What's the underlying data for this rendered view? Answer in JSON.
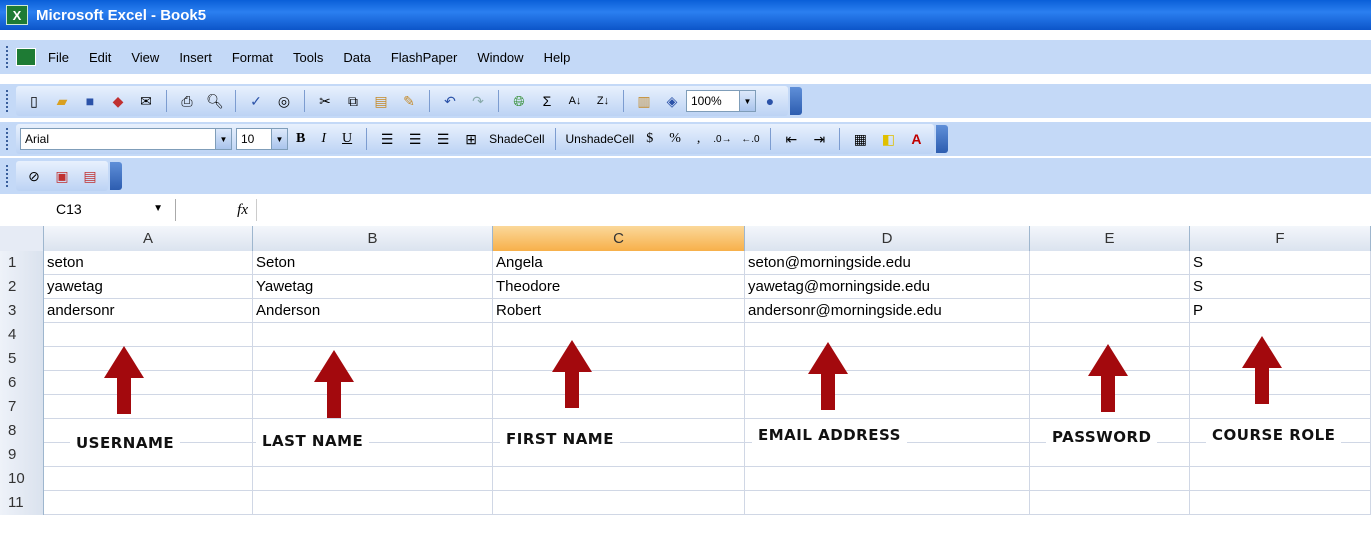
{
  "window": {
    "title": "Microsoft Excel - Book5",
    "app_icon": "excel-icon"
  },
  "menu": [
    "File",
    "Edit",
    "View",
    "Insert",
    "Format",
    "Tools",
    "Data",
    "FlashPaper",
    "Window",
    "Help"
  ],
  "standard_toolbar": {
    "zoom": "100%"
  },
  "formatting_toolbar": {
    "font": "Arial",
    "size": "10",
    "bold": "B",
    "italic": "I",
    "underline": "U",
    "shade_cell": "ShadeCell",
    "unshade_cell": "UnshadeCell",
    "currency": "$",
    "percent": "%",
    "comma": ","
  },
  "formula_bar": {
    "name_box": "C13",
    "fx": "fx",
    "formula": ""
  },
  "columns": [
    "A",
    "B",
    "C",
    "D",
    "E",
    "F"
  ],
  "selected_column": "C",
  "row_numbers": [
    "1",
    "2",
    "3",
    "4",
    "5",
    "6",
    "7",
    "8",
    "9",
    "10",
    "11"
  ],
  "rows": [
    [
      "seton",
      "Seton",
      "Angela",
      "seton@morningside.edu",
      "",
      "S"
    ],
    [
      "yawetag",
      "Yawetag",
      "Theodore",
      "yawetag@morningside.edu",
      "",
      "S"
    ],
    [
      "andersonr",
      "Anderson",
      "Robert",
      "andersonr@morningside.edu",
      "",
      "P"
    ]
  ],
  "annotations": {
    "username": "USERNAME",
    "last_name": "LAST NAME",
    "first_name": "FIRST NAME",
    "email": "EMAIL ADDRESS",
    "password": "PASSWORD",
    "course_role": "COURSE ROLE",
    "arrow_color": "#a3090d"
  }
}
